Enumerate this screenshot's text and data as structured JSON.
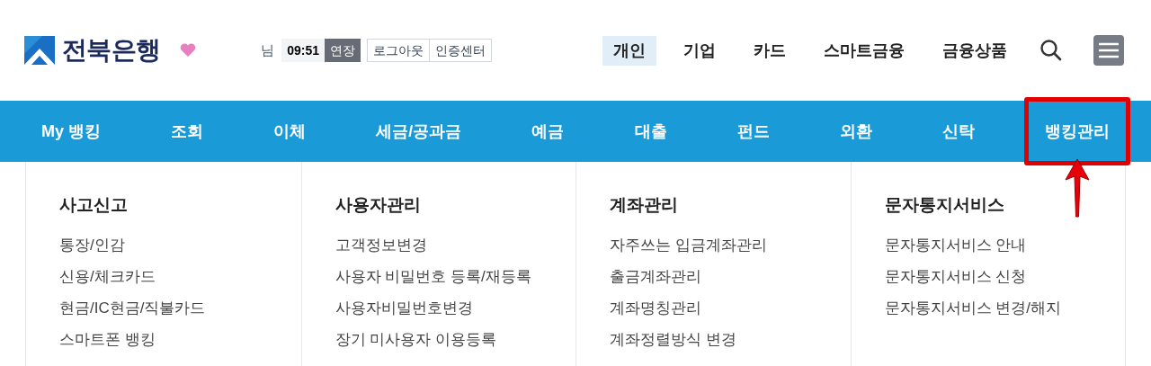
{
  "logo": {
    "text": "전북은행"
  },
  "session": {
    "suffix": "님",
    "time": "09:51",
    "extend": "연장",
    "buttons": [
      "로그아웃",
      "인증센터"
    ]
  },
  "top_nav": [
    {
      "label": "개인",
      "selected": true
    },
    {
      "label": "기업",
      "selected": false
    },
    {
      "label": "카드",
      "selected": false
    },
    {
      "label": "스마트금융",
      "selected": false
    },
    {
      "label": "금융상품",
      "selected": false
    }
  ],
  "main_nav": [
    {
      "label": "My 뱅킹",
      "highlighted": false
    },
    {
      "label": "조회",
      "highlighted": false
    },
    {
      "label": "이체",
      "highlighted": false
    },
    {
      "label": "세금/공과금",
      "highlighted": false
    },
    {
      "label": "예금",
      "highlighted": false
    },
    {
      "label": "대출",
      "highlighted": false
    },
    {
      "label": "펀드",
      "highlighted": false
    },
    {
      "label": "외환",
      "highlighted": false
    },
    {
      "label": "신탁",
      "highlighted": false
    },
    {
      "label": "뱅킹관리",
      "highlighted": true
    }
  ],
  "menu_columns": [
    {
      "heading": "사고신고",
      "items": [
        "통장/인감",
        "신용/체크카드",
        "현금/IC현금/직불카드",
        "스마트폰 뱅킹"
      ]
    },
    {
      "heading": "사용자관리",
      "items": [
        "고객정보변경",
        "사용자 비밀번호 등록/재등록",
        "사용자비밀번호변경",
        "장기 미사용자 이용등록"
      ]
    },
    {
      "heading": "계좌관리",
      "items": [
        "자주쓰는 입금계좌관리",
        "출금계좌관리",
        "계좌명칭관리",
        "계좌정렬방식 변경"
      ]
    },
    {
      "heading": "문자통지서비스",
      "items": [
        "문자통지서비스 안내",
        "문자통지서비스 신청",
        "문자통지서비스 변경/해지"
      ]
    }
  ]
}
